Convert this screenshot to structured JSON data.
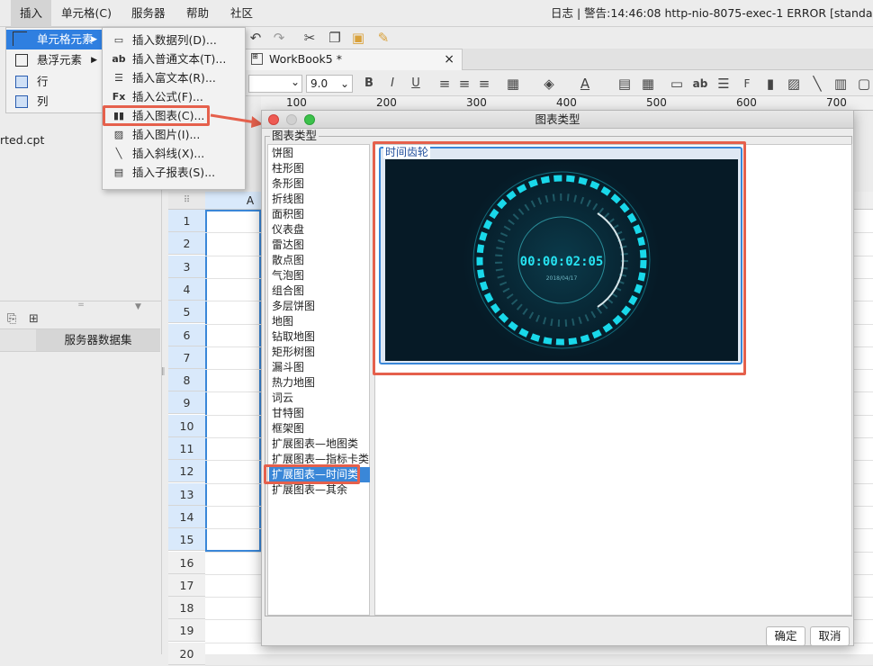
{
  "menubar": {
    "items": [
      "插入",
      "单元格(C)",
      "服务器",
      "帮助",
      "社区"
    ],
    "status": "日志 | 警告:14:46:08 http-nio-8075-exec-1 ERROR [standard"
  },
  "submenu": {
    "items": [
      "单元格元素",
      "悬浮元素",
      "行",
      "列"
    ]
  },
  "dropdown": {
    "items": [
      {
        "icon": "data-column-icon",
        "label": "插入数据列(D)..."
      },
      {
        "icon": "plain-text-icon",
        "label": "插入普通文本(T)..."
      },
      {
        "icon": "rich-text-icon",
        "label": "插入富文本(R)..."
      },
      {
        "icon": "formula-icon",
        "label": "插入公式(F)..."
      },
      {
        "icon": "chart-icon",
        "label": "插入图表(C)..."
      },
      {
        "icon": "image-icon",
        "label": "插入图片(I)..."
      },
      {
        "icon": "slash-icon",
        "label": "插入斜线(X)..."
      },
      {
        "icon": "subreport-icon",
        "label": "插入子报表(S)..."
      }
    ]
  },
  "left": {
    "file": "rted.cpt",
    "dataset_tab": "服务器数据集"
  },
  "doctab": {
    "label": "WorkBook5 *",
    "close": "×"
  },
  "format": {
    "font_size": "9.0",
    "bold": "B",
    "italic": "I",
    "underline": "U",
    "text_ab": "ab"
  },
  "ruler": [
    "100",
    "200",
    "300",
    "400",
    "500",
    "600",
    "700"
  ],
  "sheet": {
    "col_a": "A",
    "rows": [
      "1",
      "2",
      "3",
      "4",
      "5",
      "6",
      "7",
      "8",
      "9",
      "10",
      "11",
      "12",
      "13",
      "14",
      "15",
      "16",
      "17",
      "18",
      "19",
      "20"
    ]
  },
  "dialog": {
    "title": "图表类型",
    "group_label": "图表类型",
    "types": [
      "饼图",
      "柱形图",
      "条形图",
      "折线图",
      "面积图",
      "仪表盘",
      "雷达图",
      "散点图",
      "气泡图",
      "组合图",
      "多层饼图",
      "地图",
      "钻取地图",
      "矩形树图",
      "漏斗图",
      "热力地图",
      "词云",
      "甘特图",
      "框架图",
      "扩展图表—地图类",
      "扩展图表—指标卡类",
      "扩展图表—时间类",
      "扩展图表—其余"
    ],
    "selected": "扩展图表—时间类",
    "preview_label": "时间齿轮",
    "clock_time": "00:00:02:05",
    "clock_date": "2018/04/17",
    "ok": "确定",
    "cancel": "取消"
  },
  "colors": {
    "accent": "#3a87d8",
    "highlight": "#e5604c",
    "clock_bg": "#061a26",
    "clock_glow": "#19d8ea"
  }
}
